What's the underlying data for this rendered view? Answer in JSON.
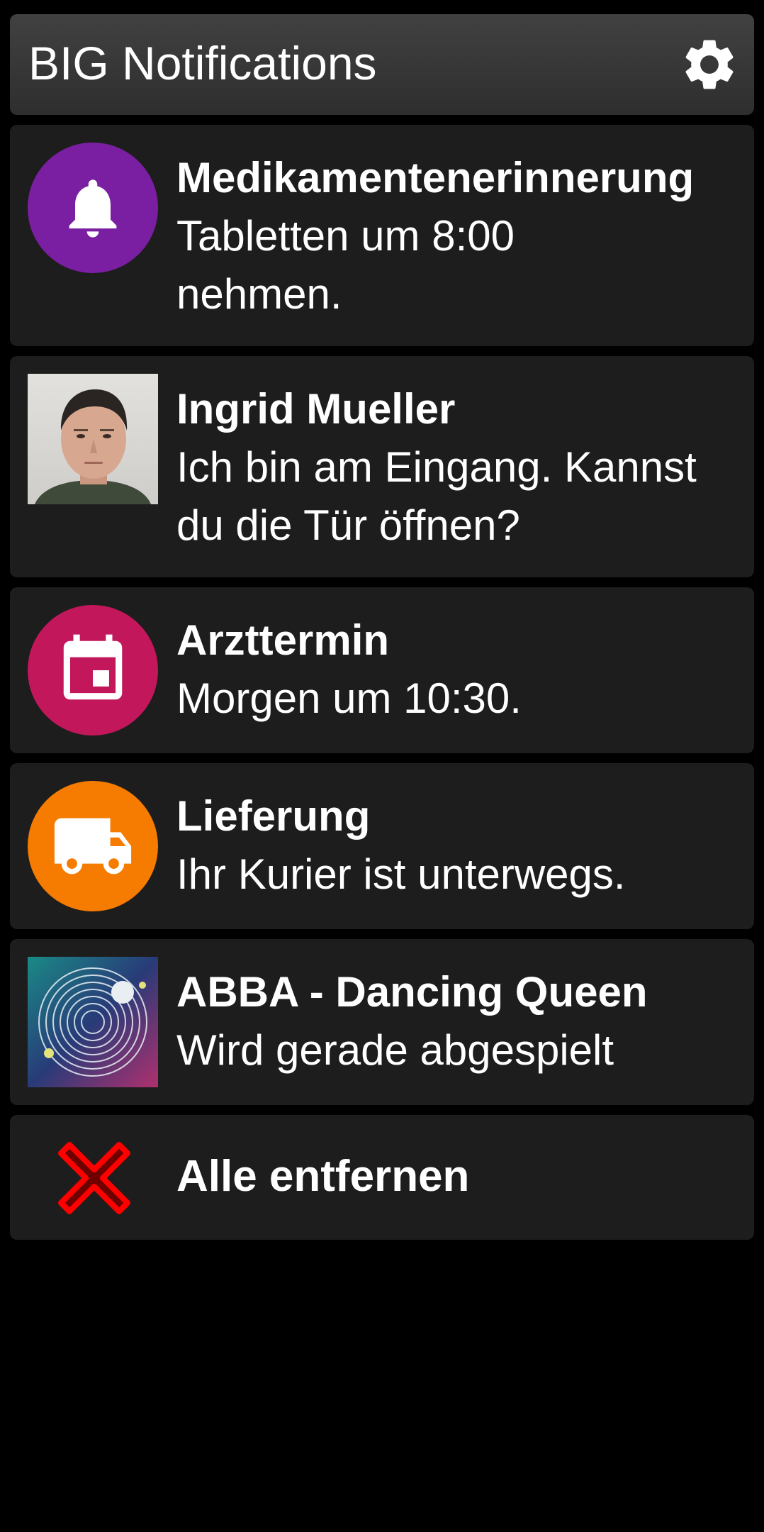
{
  "header": {
    "title": "BIG Notifications",
    "settings_icon": "gear-icon"
  },
  "notifications": [
    {
      "icon": "bell-icon",
      "icon_bg": "#7b1fa2",
      "title": "Medikamentenerinnerung",
      "body": "Tabletten um 8:00 nehmen."
    },
    {
      "icon": "contact-avatar",
      "title": "Ingrid Mueller",
      "body": "Ich bin am Eingang. Kannst du die Tür öffnen?"
    },
    {
      "icon": "calendar-icon",
      "icon_bg": "#c2185b",
      "title": "Arzttermin",
      "body": "Morgen um 10:30."
    },
    {
      "icon": "truck-icon",
      "icon_bg": "#f57c00",
      "title": "Lieferung",
      "body": "Ihr Kurier ist unterwegs."
    },
    {
      "icon": "album-art",
      "title": "ABBA - Dancing Queen",
      "body": "Wird gerade abgespielt"
    }
  ],
  "clear_all": {
    "label": "Alle entfernen",
    "icon": "close-icon",
    "icon_color": "#ff0000"
  },
  "colors": {
    "background": "#000000",
    "card": "#1d1d1d",
    "header": "#3a3a3a",
    "text": "#ffffff"
  }
}
